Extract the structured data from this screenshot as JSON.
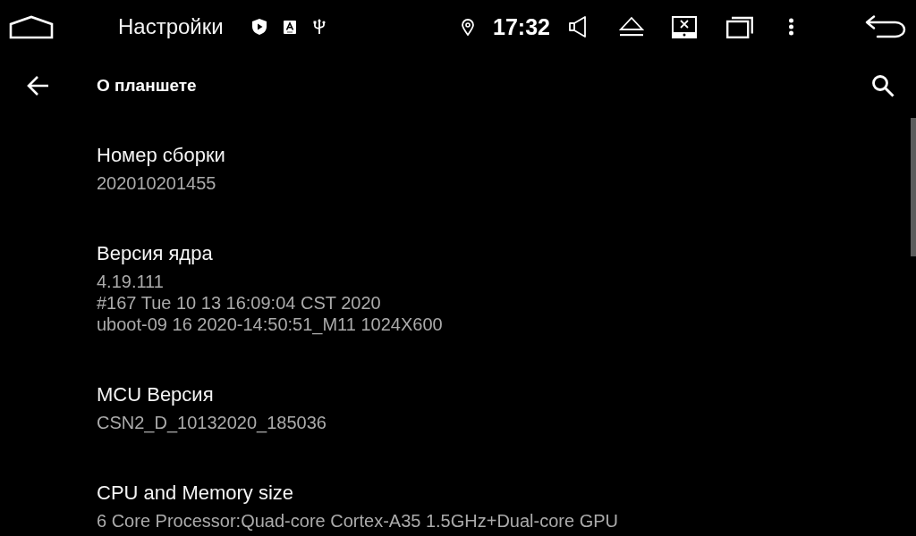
{
  "status_bar": {
    "app_title": "Настройки",
    "time": "17:32"
  },
  "toolbar": {
    "title": "О планшете"
  },
  "items": [
    {
      "title": "Номер сборки",
      "value_lines": [
        "202010201455"
      ]
    },
    {
      "title": "Версия ядра",
      "value_lines": [
        "4.19.111",
        "#167 Tue 10 13 16:09:04 CST 2020",
        "uboot-09 16 2020-14:50:51_M11 1024X600"
      ]
    },
    {
      "title": "MCU Версия",
      "value_lines": [
        "CSN2_D_10132020_185036"
      ]
    },
    {
      "title": "CPU and Memory size",
      "value_lines": [
        "6 Core Processor:Quad-core Cortex-A35 1.5GHz+Dual-core GPU"
      ]
    }
  ]
}
